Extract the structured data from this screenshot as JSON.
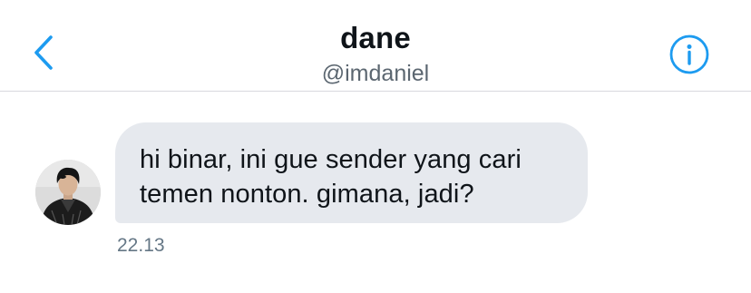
{
  "header": {
    "display_name": "dane",
    "handle": "@imdaniel",
    "back_icon": "chevron-left-icon",
    "info_icon": "info-circle-icon"
  },
  "colors": {
    "accent": "#1d9bf0",
    "bubble_background": "#e6e9ee",
    "text_primary": "#0f1419",
    "text_secondary": "#657786",
    "divider": "#d9d9de"
  },
  "conversation": {
    "messages": [
      {
        "sender": "dane",
        "avatar_icon": "user-avatar",
        "text": "hi binar, ini gue sender yang cari\ntemen nonton. gimana, jadi?",
        "timestamp": "22.13"
      }
    ]
  }
}
